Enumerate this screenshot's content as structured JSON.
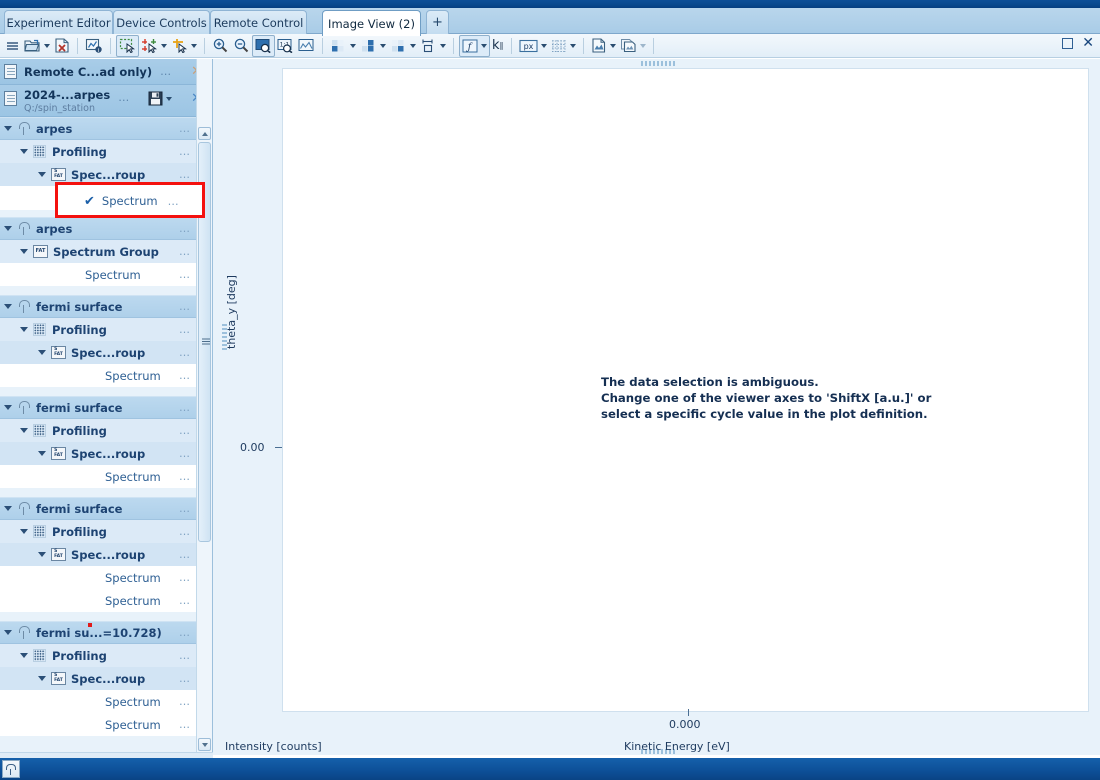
{
  "window": {
    "restore_label": "□",
    "close_label": "✕"
  },
  "tabs": [
    {
      "label": "Experiment Editor",
      "active": false
    },
    {
      "label": "Device Controls",
      "active": false
    },
    {
      "label": "Remote Control",
      "active": false
    },
    {
      "label": "Image View (2)",
      "active": true
    },
    {
      "label": "+",
      "active": false
    }
  ],
  "toolbar": {
    "groups": [
      {
        "items": [
          {
            "name": "menu-hamburger-icon",
            "glyph": "≡",
            "dropdown": false
          },
          {
            "name": "open-folder-icon",
            "glyph": "🗁",
            "dropdown": true
          },
          {
            "name": "close-document-icon",
            "glyph": "🗋",
            "dropdown": false
          }
        ]
      },
      {
        "items": [
          {
            "name": "measure-info-icon",
            "glyph": "📊",
            "dropdown": false
          }
        ]
      },
      {
        "items": [
          {
            "name": "rectangle-select-icon",
            "glyph": "⬚",
            "dropdown": false,
            "active": true
          },
          {
            "name": "crosshair-cursor-icon",
            "glyph": "✛",
            "dropdown": true
          },
          {
            "name": "marker-cursor-icon",
            "glyph": "✙",
            "dropdown": true
          }
        ]
      },
      {
        "items": [
          {
            "name": "zoom-in-icon",
            "glyph": "🔍",
            "dropdown": false
          },
          {
            "name": "zoom-out-icon",
            "glyph": "🔍",
            "dropdown": false
          },
          {
            "name": "zoom-area-icon",
            "glyph": "▣",
            "dropdown": false,
            "active": true
          },
          {
            "name": "zoom-one-to-one-icon",
            "glyph": "1:1",
            "dropdown": false
          },
          {
            "name": "zoom-fit-icon",
            "glyph": "▤",
            "dropdown": false
          }
        ]
      },
      {
        "items": [
          {
            "name": "color-scale-1-icon",
            "glyph": "◧",
            "dropdown": true
          },
          {
            "name": "color-scale-2-icon",
            "glyph": "◨",
            "dropdown": true
          },
          {
            "name": "color-scale-3-icon",
            "glyph": "◫",
            "dropdown": true
          },
          {
            "name": "aspect-ratio-icon",
            "glyph": "⬌",
            "dropdown": true
          }
        ]
      },
      {
        "items": [
          {
            "name": "function-fx-icon",
            "glyph": "ƒ",
            "dropdown": true,
            "active": true
          },
          {
            "name": "k-parallel-icon",
            "glyph": "k∥",
            "dropdown": false
          }
        ]
      },
      {
        "items": [
          {
            "name": "pixel-units-icon",
            "glyph": "px",
            "dropdown": true
          },
          {
            "name": "grid-toggle-icon",
            "glyph": "░",
            "dropdown": true
          }
        ]
      },
      {
        "items": [
          {
            "name": "export-image-icon",
            "glyph": "🖼",
            "dropdown": true
          },
          {
            "name": "copy-image-icon",
            "glyph": "🖻",
            "dropdown": true,
            "disabled": true
          }
        ]
      }
    ]
  },
  "documents": [
    {
      "title": "Remote C...ad only)",
      "subtitle": "",
      "has_save": false,
      "dots": "…",
      "close": "✕"
    },
    {
      "title": "2024-...arpes",
      "subtitle": "Q:/spin_station",
      "has_save": true,
      "dots": "…",
      "close": "✕"
    }
  ],
  "tree": [
    {
      "level": 0,
      "label": "arpes",
      "icon": "lamp-icon",
      "twisty": true,
      "dots": "…"
    },
    {
      "level": 1,
      "label": "Profiling",
      "icon": "grid-icon",
      "twisty": true,
      "dots": "…"
    },
    {
      "level": 2,
      "label": "Spec...roup",
      "icon": "fat-icon",
      "twisty": true,
      "dots": "…"
    },
    {
      "level": 3,
      "label": "Spectrum",
      "icon": "check-icon",
      "twisty": false,
      "dots": "…",
      "highlighted": true
    },
    {
      "level": 0,
      "label": "arpes",
      "icon": "lamp-icon",
      "twisty": true,
      "dots": "…"
    },
    {
      "level": 1,
      "label": "Spectrum Group",
      "icon": "fat-icon",
      "twisty": true,
      "dots": "…"
    },
    {
      "level": 2,
      "label": "Spectrum",
      "icon": "none",
      "twisty": false,
      "dots": "…"
    },
    {
      "level": 0,
      "label": "fermi surface",
      "icon": "lamp-icon",
      "twisty": true,
      "dots": "…"
    },
    {
      "level": 1,
      "label": "Profiling",
      "icon": "grid-icon",
      "twisty": true,
      "dots": "…"
    },
    {
      "level": 2,
      "label": "Spec...roup",
      "icon": "fat-icon",
      "twisty": true,
      "dots": "…"
    },
    {
      "level": 3,
      "label": "Spectrum",
      "icon": "none",
      "twisty": false,
      "dots": "…"
    },
    {
      "level": 0,
      "label": "fermi surface",
      "icon": "lamp-icon",
      "twisty": true,
      "dots": "…"
    },
    {
      "level": 1,
      "label": "Profiling",
      "icon": "grid-icon",
      "twisty": true,
      "dots": "…"
    },
    {
      "level": 2,
      "label": "Spec...roup",
      "icon": "fat-icon",
      "twisty": true,
      "dots": "…"
    },
    {
      "level": 3,
      "label": "Spectrum",
      "icon": "none",
      "twisty": false,
      "dots": "…"
    },
    {
      "level": 0,
      "label": "fermi surface",
      "icon": "lamp-icon",
      "twisty": true,
      "dots": "…"
    },
    {
      "level": 1,
      "label": "Profiling",
      "icon": "grid-icon",
      "twisty": true,
      "dots": "…"
    },
    {
      "level": 2,
      "label": "Spec...roup",
      "icon": "fat-icon",
      "twisty": true,
      "dots": "…"
    },
    {
      "level": 3,
      "label": "Spectrum",
      "icon": "none",
      "twisty": false,
      "dots": "…"
    },
    {
      "level": 3,
      "label": "Spectrum",
      "icon": "none",
      "twisty": false,
      "dots": "…"
    },
    {
      "level": 0,
      "label": "fermi su...=10.728)",
      "icon": "lamp-icon",
      "twisty": true,
      "dots": "…",
      "marker": true
    },
    {
      "level": 1,
      "label": "Profiling",
      "icon": "grid-icon",
      "twisty": true,
      "dots": "…"
    },
    {
      "level": 2,
      "label": "Spec...roup",
      "icon": "fat-icon",
      "twisty": true,
      "dots": "…"
    },
    {
      "level": 3,
      "label": "Spectrum",
      "icon": "none",
      "twisty": false,
      "dots": "…"
    },
    {
      "level": 3,
      "label": "Spectrum",
      "icon": "none",
      "twisty": false,
      "dots": "…"
    }
  ],
  "plot": {
    "message_line1": "The data selection is ambiguous.",
    "message_line2": "Change one of the viewer axes to 'ShiftX [a.u.]' or",
    "message_line3": "select a specific cycle value in the plot definition.",
    "y_axis_label": "theta_y [deg]",
    "y_tick": "0.00",
    "x_tick": "0.000",
    "x_axis_label": "Kinetic Energy [eV]",
    "intensity_label": "Intensity [counts]"
  },
  "colors": {
    "accent": "#0d4f97",
    "highlight": "#f4110f",
    "panel_bg": "#e8f2fa",
    "row_selected": "#aed0ea"
  }
}
